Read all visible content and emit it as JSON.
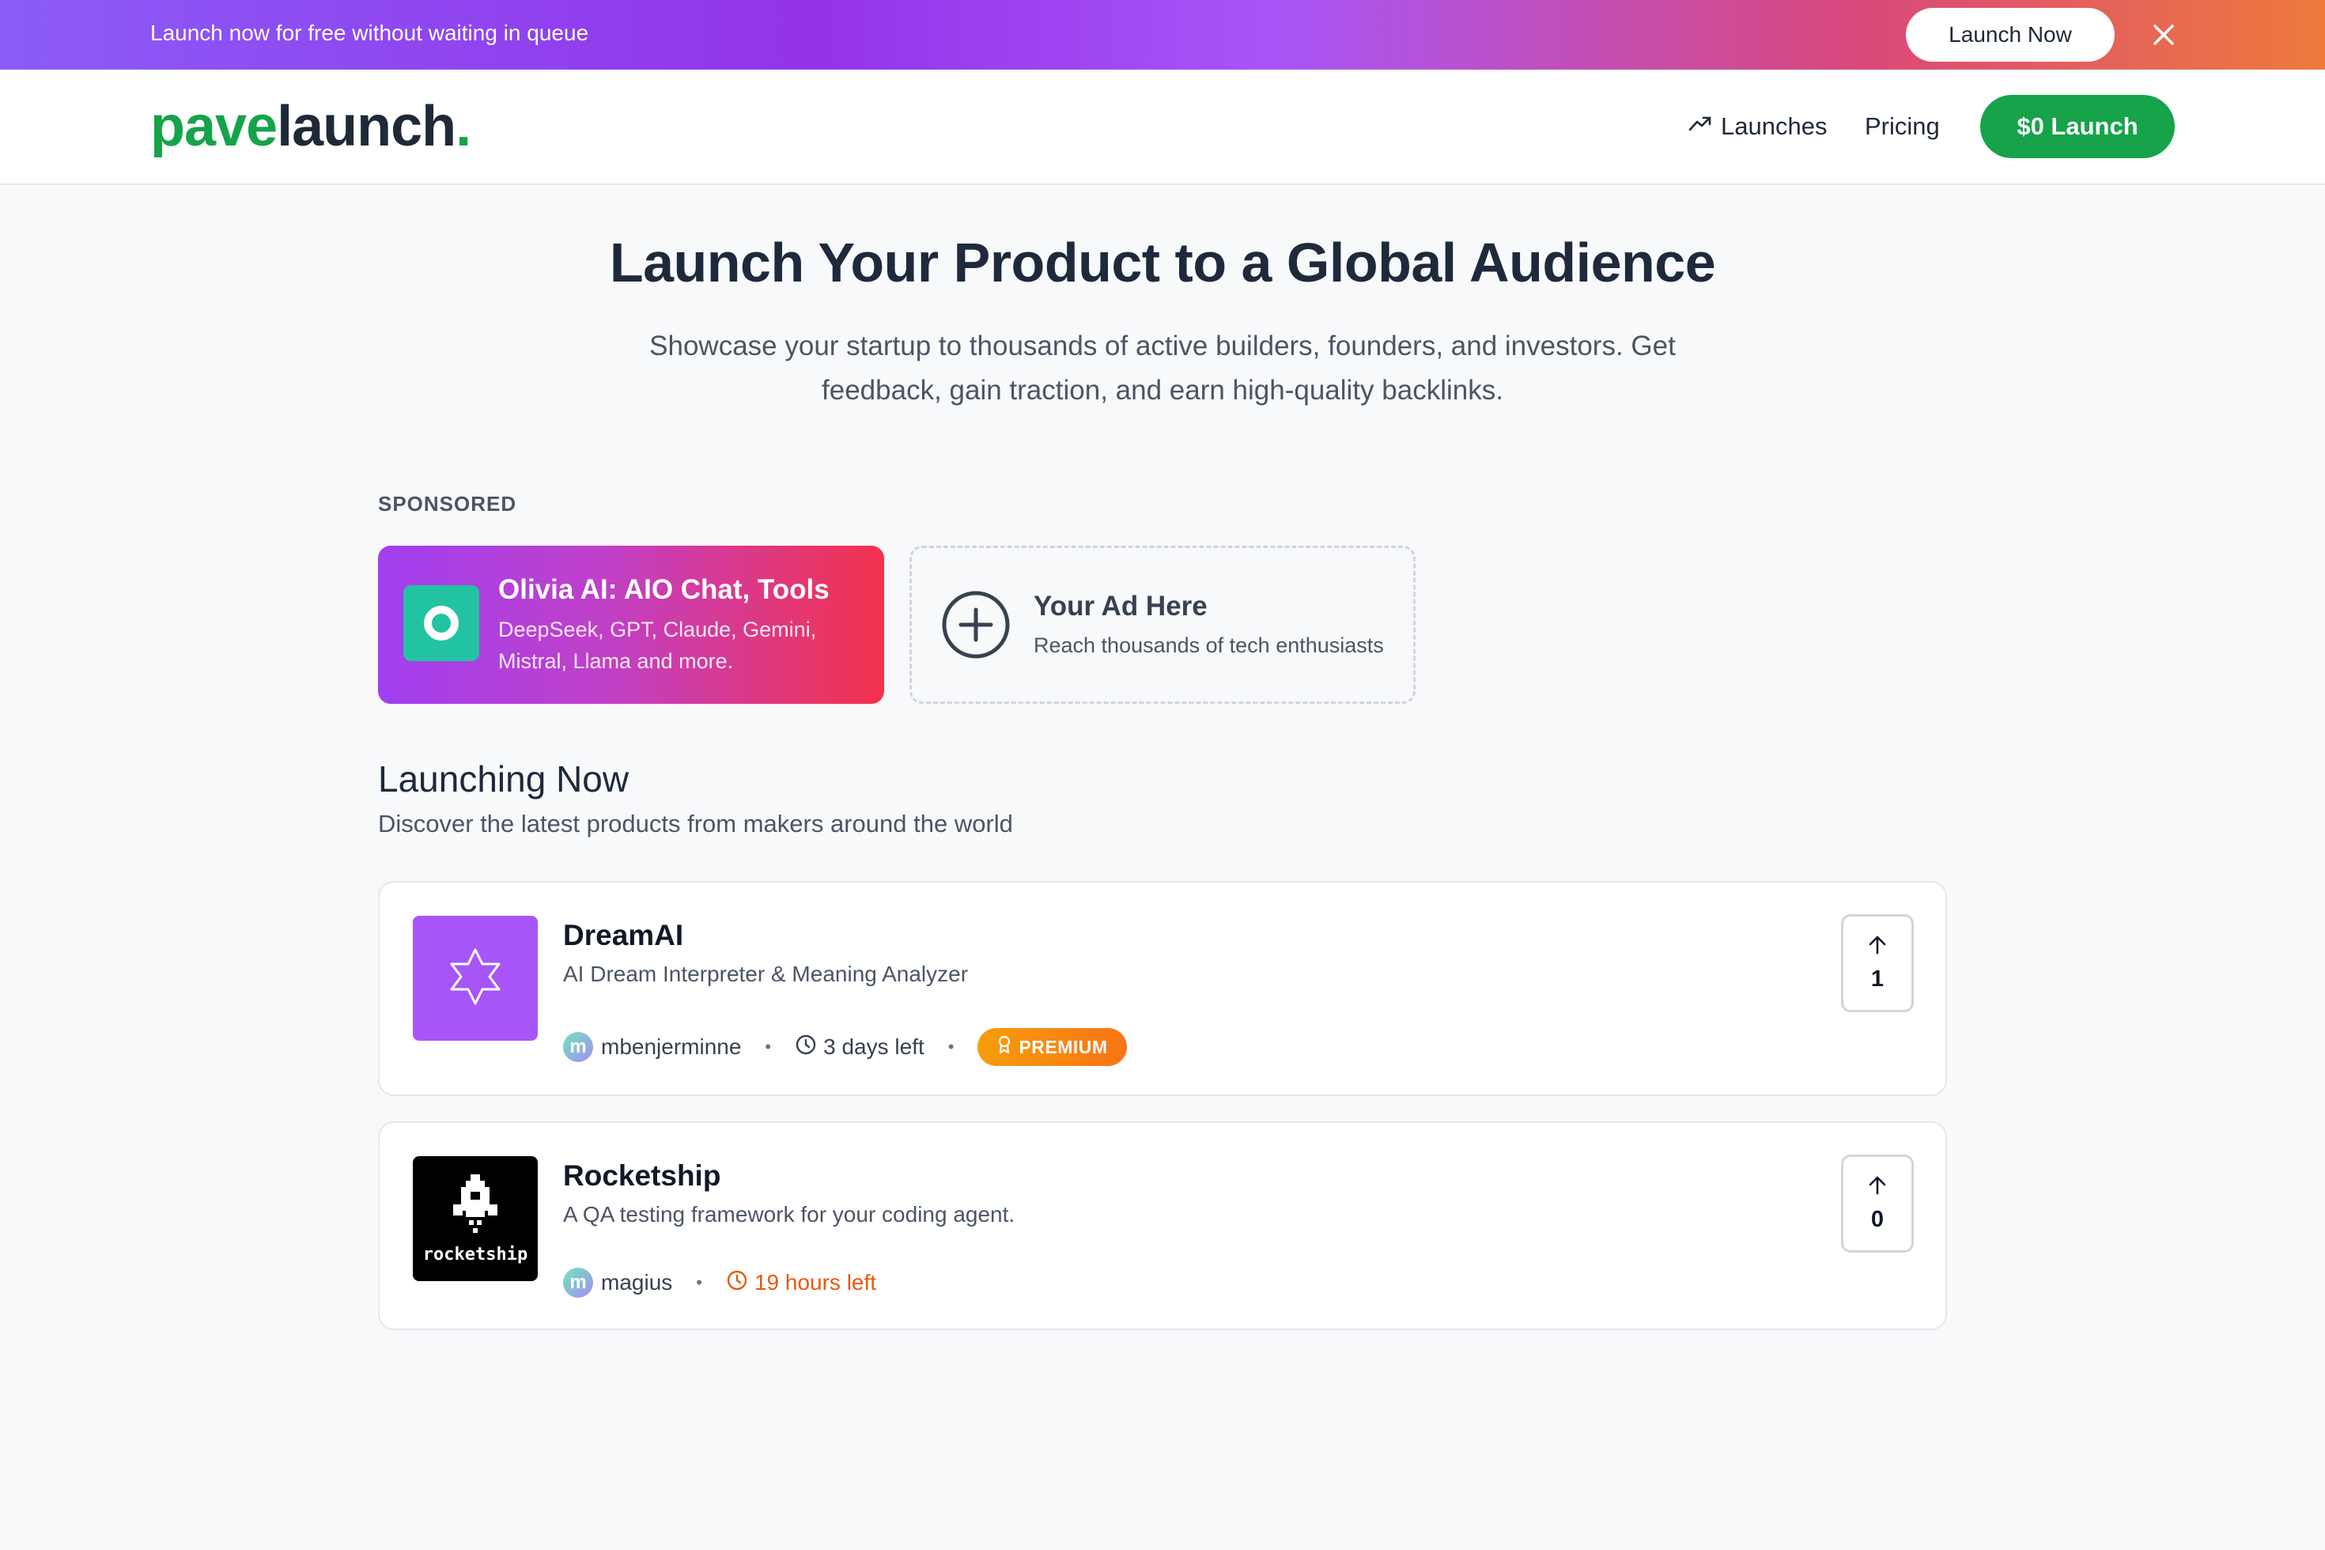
{
  "banner": {
    "text": "Launch now for free without waiting in queue",
    "cta_label": "Launch Now"
  },
  "header": {
    "logo_part1": "pave",
    "logo_part2": "launch",
    "logo_dot": ".",
    "nav": [
      {
        "label": "Launches",
        "icon": "trending-up-icon"
      },
      {
        "label": "Pricing"
      }
    ],
    "cta_label": "$0 Launch"
  },
  "hero": {
    "title": "Launch Your Product to a Global Audience",
    "subtitle": "Showcase your startup to thousands of active builders, founders, and investors. Get feedback, gain traction, and earn high-quality backlinks."
  },
  "sponsored": {
    "label": "SPONSORED",
    "sponsor": {
      "title": "Olivia AI: AIO Chat, Tools",
      "description": "DeepSeek, GPT, Claude, Gemini, Mistral, Llama and more."
    },
    "ad_slot": {
      "title": "Your Ad Here",
      "description": "Reach thousands of tech enthusiasts"
    }
  },
  "launching": {
    "title": "Launching Now",
    "subtitle": "Discover the latest products from makers around the world",
    "products": [
      {
        "name": "DreamAI",
        "tagline": "AI Dream Interpreter & Meaning Analyzer",
        "avatar_letter": "m",
        "maker": "mbenjerminne",
        "time_left": "3 days left",
        "badge": "PREMIUM",
        "upvotes": "1"
      },
      {
        "name": "Rocketship",
        "tagline": "A QA testing framework for your coding agent.",
        "thumb_text": "rocketship",
        "avatar_letter": "m",
        "maker": "magius",
        "time_left": "19 hours left",
        "upvotes": "0"
      }
    ]
  },
  "colors": {
    "brand_green": "#16a34a",
    "urgent_orange": "#ea580c",
    "premium_gradient_start": "#f59e0b"
  }
}
